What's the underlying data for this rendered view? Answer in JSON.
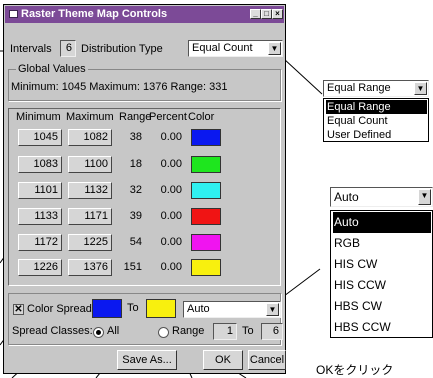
{
  "window": {
    "title": "Raster Theme Map Controls",
    "colors": {
      "titlebar": "#7c4a97",
      "face": "#c7c7c7"
    }
  },
  "toolbar": {
    "intervals_label": "Intervals",
    "intervals_value": "6",
    "distribution_label": "Distribution Type",
    "distribution_value": "Equal Count"
  },
  "global_values": {
    "legend": "Global Values",
    "text": "Minimum: 1045  Maximum: 1376  Range: 331"
  },
  "table": {
    "headers": {
      "min": "Minimum",
      "max": "Maximum",
      "range": "Range",
      "percent": "Percent",
      "color": "Color"
    },
    "rows": [
      {
        "min": "1045",
        "max": "1082",
        "range": "38",
        "percent": "0.00",
        "color": "#0a18f0"
      },
      {
        "min": "1083",
        "max": "1100",
        "range": "18",
        "percent": "0.00",
        "color": "#1ee61e"
      },
      {
        "min": "1101",
        "max": "1132",
        "range": "32",
        "percent": "0.00",
        "color": "#2ff0f0"
      },
      {
        "min": "1133",
        "max": "1171",
        "range": "39",
        "percent": "0.00",
        "color": "#f01414"
      },
      {
        "min": "1172",
        "max": "1225",
        "range": "54",
        "percent": "0.00",
        "color": "#f014f0"
      },
      {
        "min": "1226",
        "max": "1376",
        "range": "151",
        "percent": "0.00",
        "color": "#f8f00e"
      }
    ]
  },
  "color_spread": {
    "checkbox_label": "Color Spread",
    "checked": true,
    "from_color": "#0a18f0",
    "to_label": "To",
    "to_color": "#f8f00e",
    "method_value": "Auto",
    "classes_label": "Spread Classes:",
    "all_label": "All",
    "range_label": "Range",
    "range_from": "1",
    "range_to_label": "To",
    "range_to": "6",
    "selected_mode": "all"
  },
  "buttons": {
    "save_as": "Save As...",
    "ok": "OK",
    "cancel": "Cancel"
  },
  "distribution_popup": {
    "current": "Equal Range",
    "options": [
      "Equal Range",
      "Equal Count",
      "User Defined"
    ],
    "highlighted": "Equal Range"
  },
  "method_popup": {
    "current": "Auto",
    "options": [
      "Auto",
      "RGB",
      "HIS CW",
      "HIS CCW",
      "HBS CW",
      "HBS CCW"
    ],
    "highlighted": "Auto"
  },
  "caption": "OKをクリック"
}
